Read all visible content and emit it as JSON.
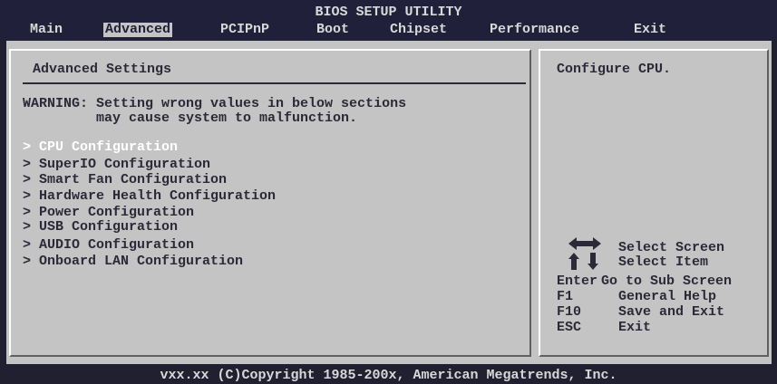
{
  "header": {
    "title": "BIOS SETUP UTILITY"
  },
  "menu": {
    "main": "Main",
    "advanced": "Advanced",
    "pcipnp": "PCIPnP",
    "boot": "Boot",
    "chipset": "Chipset",
    "performance": "Performance",
    "exit": "Exit"
  },
  "panel": {
    "heading": "Advanced Settings",
    "warning_line1": "WARNING: Setting wrong values in below sections",
    "warning_line2": "         may cause system to malfunction.",
    "items": [
      "> CPU Configuration",
      "> SuperIO Configuration",
      "> Smart Fan Configuration",
      "> Hardware Health Configuration",
      "> Power Configuration",
      "> USB Configuration",
      "> AUDIO Configuration",
      "> Onboard LAN Configuration"
    ],
    "selected_index": 0
  },
  "help": {
    "description": "Configure CPU.",
    "keys": [
      {
        "key": "",
        "action": "Select Screen"
      },
      {
        "key": "",
        "action": "Select Item"
      },
      {
        "key": "Enter",
        "action": "Go to Sub Screen"
      },
      {
        "key": "F1",
        "action": "General Help"
      },
      {
        "key": "F10",
        "action": "Save and Exit"
      },
      {
        "key": "ESC",
        "action": "Exit"
      }
    ]
  },
  "footer": {
    "copyright": "vxx.xx (C)Copyright 1985-200x, American Megatrends, Inc."
  },
  "colors": {
    "background": "#c4c4c4",
    "header_bg": "#20203a",
    "text_dark": "#2a2a38",
    "selected_text": "#ffffff"
  }
}
